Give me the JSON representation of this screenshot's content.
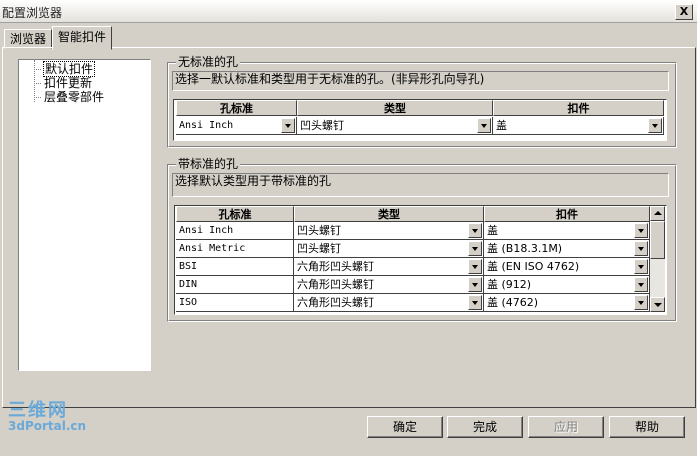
{
  "window": {
    "title": "配置浏览器",
    "close_label": "X"
  },
  "tabs": [
    {
      "label": "浏览器",
      "active": false
    },
    {
      "label": "智能扣件",
      "active": true
    }
  ],
  "tree": {
    "items": [
      {
        "label": "默认扣件",
        "selected": true
      },
      {
        "label": "扣件更新",
        "selected": false
      },
      {
        "label": "层叠零部件",
        "selected": false
      }
    ]
  },
  "no_std": {
    "title": "无标准的孔",
    "description": "选择一默认标准和类型用于无标准的孔。(非异形孔向导孔)",
    "headers": [
      "孔标准",
      "类型",
      "扣件"
    ],
    "row": [
      "Ansi Inch",
      "凹头螺钉",
      "盖"
    ]
  },
  "with_std": {
    "title": "带标准的孔",
    "description": "选择默认类型用于带标准的孔",
    "headers": [
      "孔标准",
      "类型",
      "扣件"
    ],
    "rows": [
      [
        "Ansi Inch",
        "凹头螺钉",
        "盖"
      ],
      [
        "Ansi Metric",
        "凹头螺钉",
        "盖 (B18.3.1M)"
      ],
      [
        "BSI",
        "六角形凹头螺钉",
        "盖 (EN ISO 4762)"
      ],
      [
        "DIN",
        "六角形凹头螺钉",
        "盖 (912)"
      ],
      [
        "ISO",
        "六角形凹头螺钉",
        "盖 (4762)"
      ]
    ]
  },
  "buttons": {
    "ok": "确定",
    "finish": "完成",
    "apply": "应用",
    "help": "帮助"
  },
  "watermark": {
    "line1": "三维网",
    "line2": "3dPortal.cn"
  }
}
